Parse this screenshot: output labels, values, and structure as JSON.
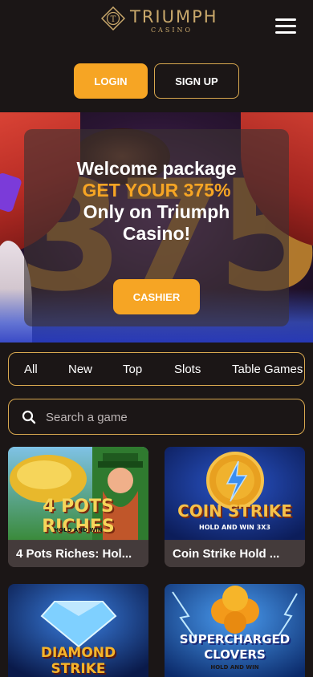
{
  "header": {
    "brand_title": "TRIUMPH",
    "brand_subtitle": "CASINO",
    "menu_icon": "hamburger-menu-icon"
  },
  "auth": {
    "login_label": "LOGIN",
    "signup_label": "SIGN UP"
  },
  "banner": {
    "line1": "Welcome package",
    "line2": "GET YOUR 375%",
    "line3": "Only on Triumph",
    "line4": "Casino!",
    "cashier_label": "CASHIER",
    "accent_color": "#f6a524"
  },
  "categories": [
    "All",
    "New",
    "Top",
    "Slots",
    "Table Games"
  ],
  "search": {
    "placeholder": "Search a game",
    "icon": "search-icon"
  },
  "games": [
    {
      "title": "4 Pots Riches: Hol...",
      "art": "4 POTS RICHES",
      "art_sub": "HOLD AND WIN"
    },
    {
      "title": "Coin Strike Hold ...",
      "art": "COIN STRIKE",
      "art_sub": "HOLD AND WIN 3X3"
    },
    {
      "title": "",
      "art": "DIAMOND STRIKE",
      "art_sub": ""
    },
    {
      "title": "",
      "art": "SUPERCHARGED CLOVERS",
      "art_sub": "HOLD AND WIN"
    }
  ],
  "colors": {
    "background": "#1b1616",
    "gold": "#d8a84f",
    "orange": "#f6a524"
  }
}
